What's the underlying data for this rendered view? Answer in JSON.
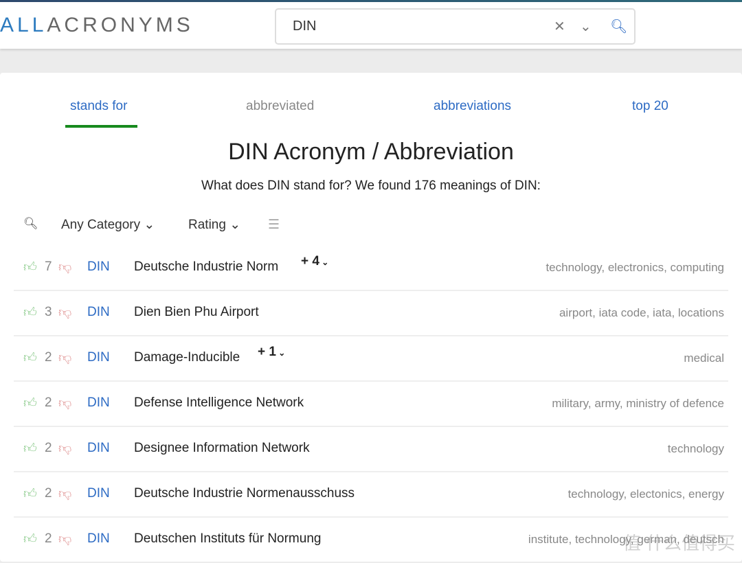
{
  "header": {
    "logo_accent": "ALL",
    "logo_rest": "ACRONYMS",
    "search_value": "DIN"
  },
  "tabs": [
    {
      "label": "stands for"
    },
    {
      "label": "abbreviated"
    },
    {
      "label": "abbreviations"
    },
    {
      "label": "top 20"
    }
  ],
  "title": "DIN Acronym / Abbreviation",
  "subtitle": "What does DIN stand for? We found 176 meanings of DIN:",
  "filters": {
    "category": "Any Category",
    "sort": "Rating"
  },
  "rows": [
    {
      "votes": "7",
      "acronym": "DIN",
      "meaning": "Deutsche Industrie Norm",
      "more": "+ 4",
      "tags": "technology, electronics, computing"
    },
    {
      "votes": "3",
      "acronym": "DIN",
      "meaning": "Dien Bien Phu Airport",
      "more": "",
      "tags": "airport, iata code, iata, locations"
    },
    {
      "votes": "2",
      "acronym": "DIN",
      "meaning": "Damage-Inducible",
      "more": "+ 1",
      "tags": "medical"
    },
    {
      "votes": "2",
      "acronym": "DIN",
      "meaning": "Defense Intelligence Network",
      "more": "",
      "tags": "military, army, ministry of defence"
    },
    {
      "votes": "2",
      "acronym": "DIN",
      "meaning": "Designee Information Network",
      "more": "",
      "tags": "technology"
    },
    {
      "votes": "2",
      "acronym": "DIN",
      "meaning": "Deutsche Industrie Normenausschuss",
      "more": "",
      "tags": "technology, electonics, energy"
    },
    {
      "votes": "2",
      "acronym": "DIN",
      "meaning": "Deutschen Instituts für Normung",
      "more": "",
      "tags": "institute, technology, german, deutsch"
    }
  ],
  "watermark": "值 什么值得买",
  "colors": {
    "link": "#2d6bc4",
    "active_tab": "#178a1e",
    "thumb_up": "#8fcc8f",
    "thumb_down": "#e29a9a"
  }
}
